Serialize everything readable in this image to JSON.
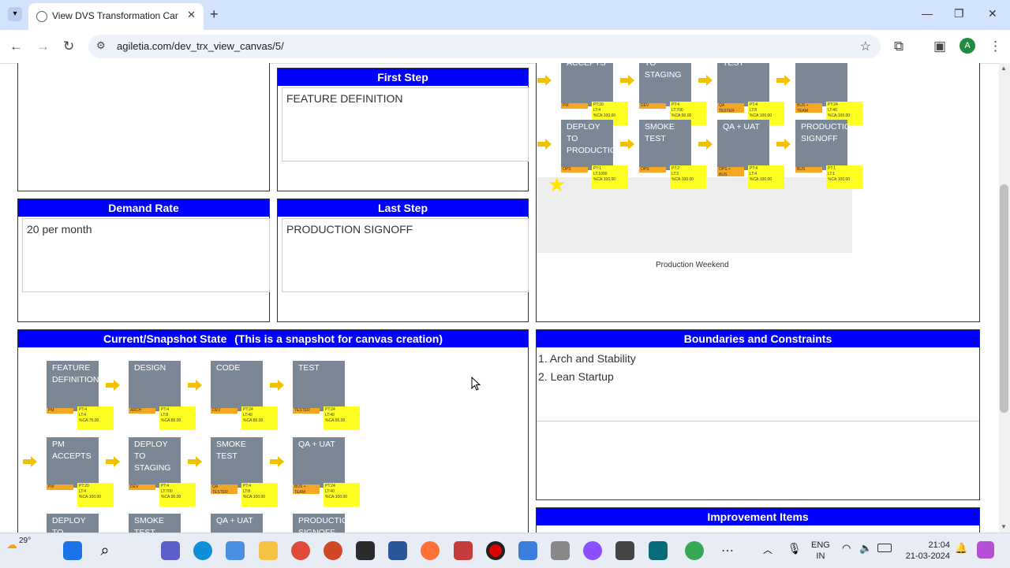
{
  "browser": {
    "tab_title": "View DVS Transformation Canvas",
    "url": "agiletia.com/dev_trx_view_canvas/5/",
    "avatar": "A"
  },
  "panels": {
    "first_step": {
      "title": "First Step",
      "value": "FEATURE DEFINITION"
    },
    "demand_rate": {
      "title": "Demand Rate",
      "value": "20 per month"
    },
    "last_step": {
      "title": "Last Step",
      "value": "PRODUCTION SIGNOFF"
    },
    "snapshot": {
      "title": "Current/Snapshot State",
      "subtitle": "(This is a snapshot for canvas creation)"
    },
    "boundaries": {
      "title": "Boundaries and Constraints",
      "items": [
        "1. Arch and Stability",
        "2. Lean Startup"
      ]
    },
    "improvement": {
      "title": "Improvement Items"
    }
  },
  "future_map": {
    "row1": [
      {
        "label": "ACCEPTS",
        "role": "PM",
        "note": "PT:20\nLT:4\n%CA:100.00"
      },
      {
        "label": "TO\nSTAGING",
        "role": "DEV",
        "note": "PT:4\nLT:700\n%CA:90.00"
      },
      {
        "label": "TEST",
        "role": "QA\nTESTER",
        "note": "PT:4\nLT:8\n%CA:100.00"
      },
      {
        "label": "",
        "role": "BUS +\nTEAM",
        "note": "PT:24\nLT:40\n%CA:100.00"
      }
    ],
    "row2": [
      {
        "label": "DEPLOY\nTO\nPRODUCTIO",
        "role": "OPS",
        "note": "PT:1\nLT:1000\n%CA:100.00"
      },
      {
        "label": "SMOKE\nTEST",
        "role": "OPS",
        "note": "PT:2\nLT:2\n%CA:100.00"
      },
      {
        "label": "QA + UAT",
        "role": "OPS +\nBUS",
        "note": "PT:4\nLT:4\n%CA:100.00"
      },
      {
        "label": "PRODUCTIO\nSIGNOFF",
        "role": "BUS",
        "note": "PT:1\nLT:1\n%CA:100.00"
      }
    ],
    "caption": "Production Weekend"
  },
  "snapshot_map": {
    "row1": [
      {
        "label": "FEATURE\nDEFINITION",
        "role": "PM",
        "note": "PT:4\nLT:4\n%CA:75.00"
      },
      {
        "label": "DESIGN",
        "role": "ARCH",
        "note": "PT:4\nLT:8\n%CA:80.00"
      },
      {
        "label": "CODE",
        "role": "DEV",
        "note": "PT:24\nLT:40\n%CA:80.00"
      },
      {
        "label": "TEST",
        "role": "TESTER",
        "note": "PT:24\nLT:40\n%CA:95.00"
      }
    ],
    "row2": [
      {
        "label": "PM\nACCEPTS",
        "role": "PM",
        "note": "PT:20\nLT:4\n%CA:100.00"
      },
      {
        "label": "DEPLOY\nTO\nSTAGING",
        "role": "DEV",
        "note": "PT:4\nLT:700\n%CA:90.00"
      },
      {
        "label": "SMOKE\nTEST",
        "role": "QA\nTESTER",
        "note": "PT:4\nLT:8\n%CA:100.00"
      },
      {
        "label": "QA + UAT",
        "role": "BUS +\nTEAM",
        "note": "PT:24\nLT:40\n%CA:100.00"
      }
    ],
    "row3": [
      {
        "label": "DEPLOY\nTO"
      },
      {
        "label": "SMOKE\nTEST"
      },
      {
        "label": "QA + UAT"
      },
      {
        "label": "PRODUCTIO\nSIGNOFF"
      }
    ]
  },
  "taskbar": {
    "weather": "29°",
    "lang1": "ENG",
    "lang2": "IN",
    "time": "21:04",
    "date": "21-03-2024"
  }
}
